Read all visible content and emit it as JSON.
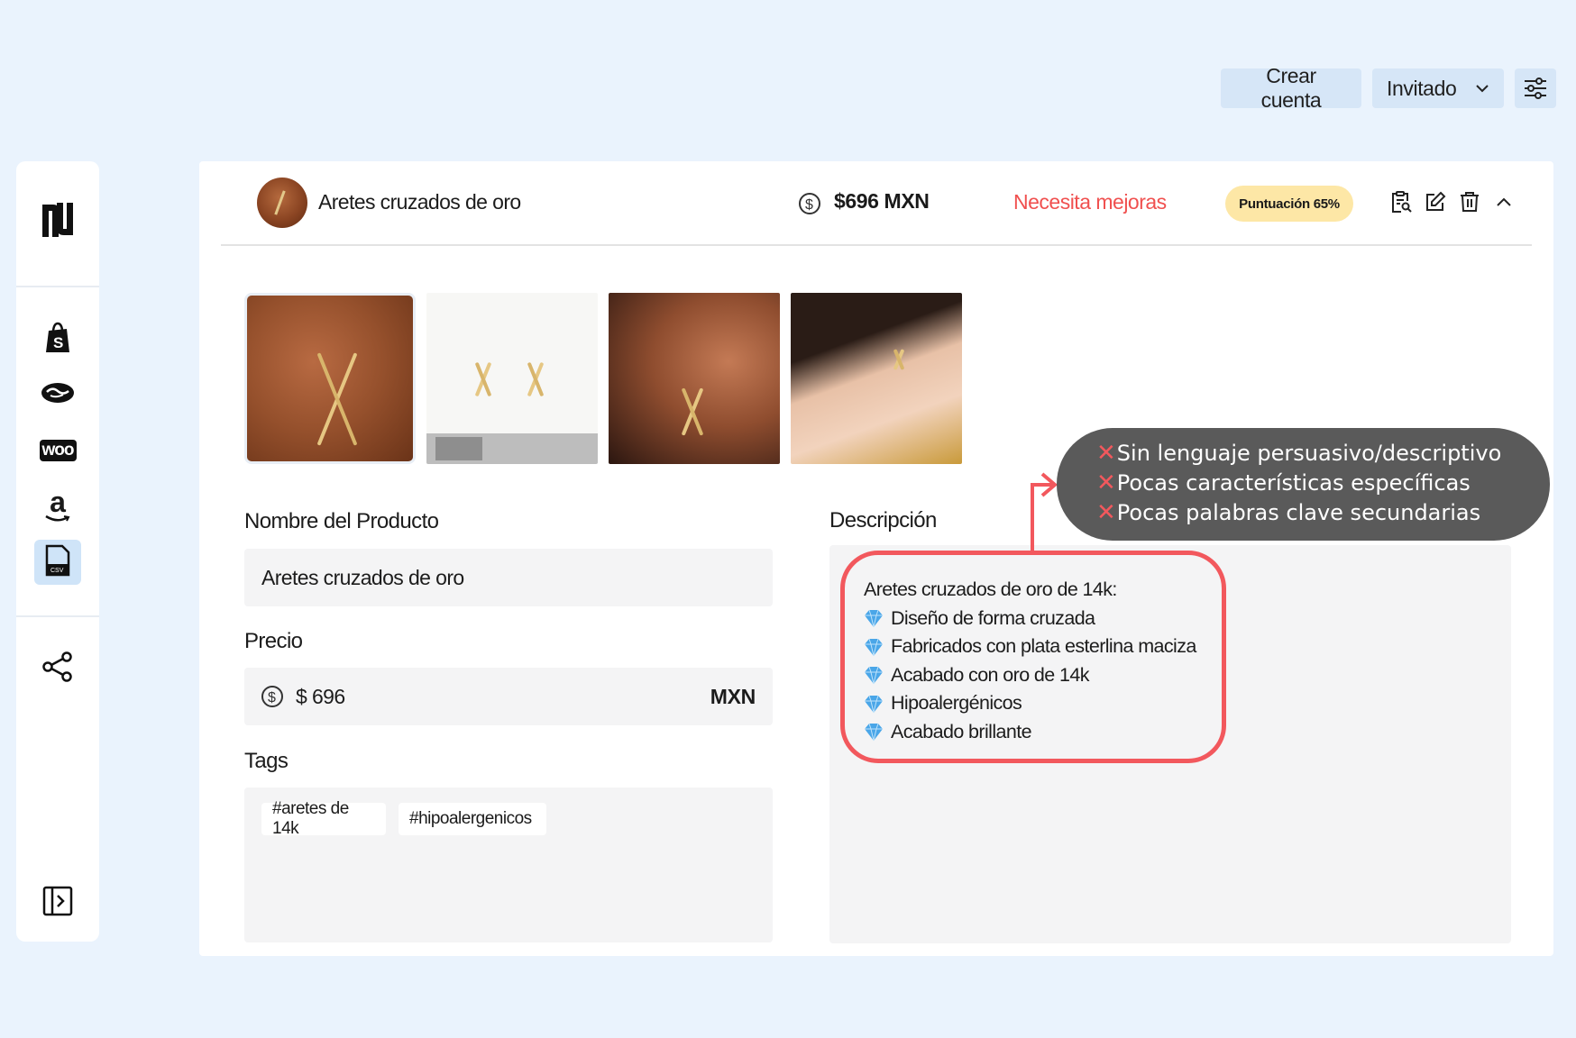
{
  "topbar": {
    "create_account": "Crear cuenta",
    "guest": "Invitado"
  },
  "sidebar": {
    "logo_icon": "brand-logo-icon",
    "items": [
      {
        "icon": "shopify-icon"
      },
      {
        "icon": "handshake-icon"
      },
      {
        "icon": "woocommerce-icon",
        "label": "woo"
      },
      {
        "icon": "amazon-icon",
        "label": "a"
      },
      {
        "icon": "csv-file-icon",
        "active": true
      },
      {
        "icon": "share-icon"
      },
      {
        "icon": "expand-sidebar-icon"
      }
    ]
  },
  "product": {
    "title": "Aretes cruzados de oro",
    "price_header": "$696 MXN",
    "status": "Necesita mejoras",
    "score": "Puntuación 65%",
    "actions": [
      "clipboard-search-icon",
      "edit-icon",
      "trash-icon",
      "chevron-up-icon"
    ]
  },
  "form": {
    "name_label": "Nombre del Producto",
    "name_value": "Aretes cruzados de oro",
    "price_label": "Precio",
    "price_value": "$ 696",
    "currency": "MXN",
    "tags_label": "Tags",
    "tags": [
      "#aretes de 14k",
      "#hipoalergenicos"
    ]
  },
  "description": {
    "label": "Descripción",
    "intro": "Aretes cruzados de oro de 14k:",
    "bullets": [
      "Diseño de forma cruzada",
      "Fabricados con plata esterlina maciza",
      "Acabado con oro de 14k",
      "Hipoalergénicos",
      "Acabado brillante"
    ]
  },
  "callout": {
    "items": [
      "Sin lenguaje persuasivo/descriptivo",
      "Pocas características específicas",
      "Pocas palabras clave secundarias"
    ]
  },
  "colors": {
    "background": "#eaf3fd",
    "status_red": "#f0504f",
    "score_bg": "#fde7a6",
    "highlight": "#f2585d",
    "callout_bg": "#5a5a5a"
  }
}
